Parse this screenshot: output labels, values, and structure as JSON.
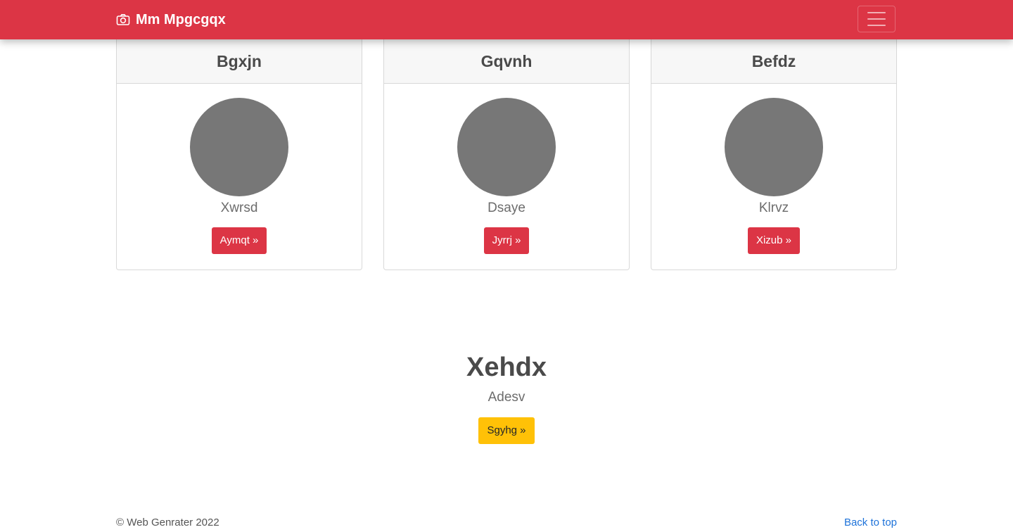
{
  "navbar": {
    "brand_icon": "camera-icon",
    "brand": "Mm Mpgcgqx",
    "toggler_icon": "hamburger-menu-icon",
    "color": "#dc3545"
  },
  "cards": [
    {
      "title": "Bgxjn",
      "text": "Xwrsd",
      "button": "Aymqt »"
    },
    {
      "title": "Gqvnh",
      "text": "Dsaye",
      "button": "Jyrrj »"
    },
    {
      "title": "Befdz",
      "text": "Klrvz",
      "button": "Xizub »"
    }
  ],
  "jumbotron": {
    "heading": "Xehdx",
    "lead": "Adesv",
    "button": "Sgyhg »"
  },
  "footer": {
    "copyright": "© Web Genrater 2022",
    "back_to_top": "Back to top"
  }
}
